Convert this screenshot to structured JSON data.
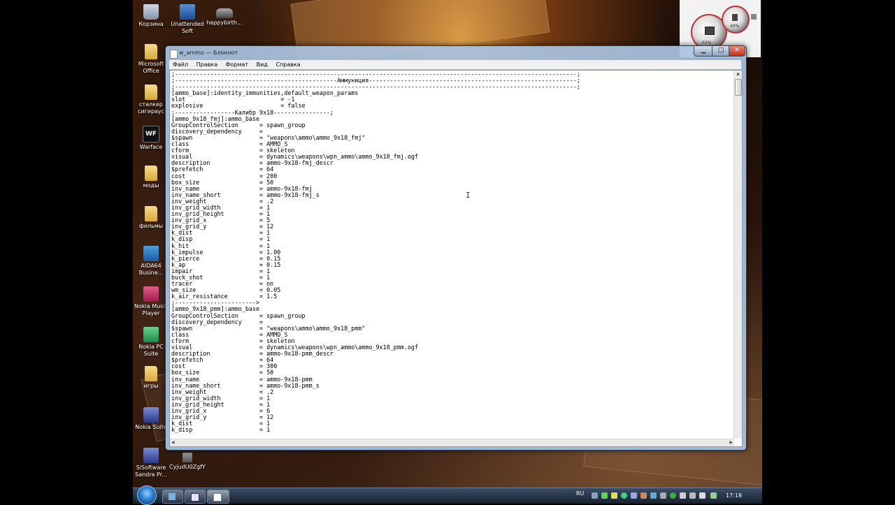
{
  "desktop": {
    "icons": [
      {
        "label": "Корзина"
      },
      {
        "label": "Unattended Soft"
      },
      {
        "label": "happybirth..."
      },
      {
        "label": "Microsoft Office"
      },
      {
        "label": "сталкер сигираус"
      },
      {
        "label": "Warface",
        "glyph": "WF"
      },
      {
        "label": "моды"
      },
      {
        "label": "фильмы"
      },
      {
        "label": "AIDA64 Busine..."
      },
      {
        "label": "Nokia Music Player"
      },
      {
        "label": "Nokia PC Suite"
      },
      {
        "label": "игры"
      },
      {
        "label": "Nokia Suite"
      },
      {
        "label": "SiSoftware Sandra Pr..."
      },
      {
        "label": "CyjudU0ZgfY"
      }
    ]
  },
  "gadget": {
    "cpu_label": "02%",
    "ram_label": "49%"
  },
  "window": {
    "title": "w_ammo — Блокнот",
    "menu": [
      "Файл",
      "Правка",
      "Формат",
      "Вид",
      "Справка"
    ],
    "content_lines": [
      ";------------------------------------------------------------------------------------------------------------------;",
      ";----------------------------------------------Аммуниция-----------------------------------------------------------;",
      ";------------------------------------------------------------------------------------------------------------------;",
      "[ammo_base]:identity_immunities,default_weapon_params",
      "slot                           = -1",
      "explosive                      = false",
      ";-----------------Калибр 9х18----------------;",
      "[ammo_9x18_fmj]:ammo_base",
      "GroupControlSection      = spawn_group",
      "discovery_dependency     =",
      "$spawn                   = \"weapons\\ammo\\ammo_9x18_fmj\"",
      "class                    = AMMO_S",
      "cform                    = skeleton",
      "visual                   = dynamics\\weapons\\wpn_ammo\\ammo_9x18_fmj.ogf",
      "description              = ammo-9x18-fmj_descr",
      "$prefetch                = 64",
      "cost                     = 200",
      "box_size                 = 50",
      "inv_name                 = ammo-9x18-fmj",
      "inv_name_short           = ammo-9x18-fmj_s",
      "inv_weight               = .2",
      "inv_grid_width           = 1",
      "inv_grid_height          = 1",
      "inv_grid_x               = 5",
      "inv_grid_y               = 12",
      "k_dist                   = 1",
      "k_disp                   = 1",
      "k_hit                    = 1",
      "k_impulse                = 1.00",
      "k_pierce                 = 0.15",
      "k_ap                     = 0.15",
      "impair                   = 1",
      "buck_shot                = 1",
      "tracer                   = on",
      "wm_size                  = 0.05",
      "k_air_resistance         = 1.5",
      ";----------------------->",
      "[ammo_9x18_pmm]:ammo_base",
      "GroupControlSection      = spawn_group",
      "discovery_dependency     =",
      "$spawn                   = \"weapons\\ammo\\ammo_9x18_pmm\"",
      "class                    = AMMO_S",
      "cform                    = skeleton",
      "visual                   = dynamics\\weapons\\wpn_ammo\\ammo_9x18_pmm.ogf",
      "description              = ammo-9x18-pmm_descr",
      "$prefetch                = 64",
      "cost                     = 300",
      "box_size                 = 50",
      "inv_name                 = ammo-9x18-pmm",
      "inv_name_short           = ammo-9x18-pmm_s",
      "inv_weight               = .2",
      "inv_grid_width           = 1",
      "inv_grid_height          = 1",
      "inv_grid_x               = 6",
      "inv_grid_y               = 12",
      "k_dist                   = 1",
      "k_disp                   = 1"
    ]
  },
  "taskbar": {
    "language": "RU",
    "clock": "17:18"
  },
  "colors": {
    "accent": "#2b7bd0",
    "close_button": "#c22b15"
  }
}
